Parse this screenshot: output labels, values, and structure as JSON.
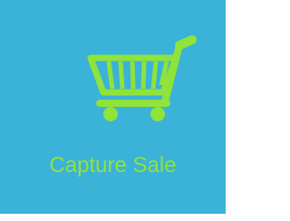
{
  "tile": {
    "label": "Capture Sale",
    "icon": "shopping-cart-icon",
    "background_color": "#3bb2d8",
    "accent_color": "#8fe33a"
  }
}
